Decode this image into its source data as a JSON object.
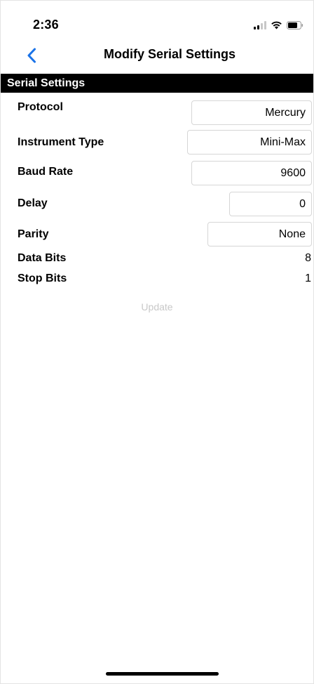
{
  "status_bar": {
    "time": "2:36"
  },
  "nav": {
    "back_icon": "chevron-left-icon",
    "title": "Modify Serial Settings"
  },
  "section": {
    "title": "Serial Settings"
  },
  "settings": {
    "protocol": {
      "label": "Protocol",
      "value": "Mercury"
    },
    "instrument_type": {
      "label": "Instrument Type",
      "value": "Mini-Max"
    },
    "baud_rate": {
      "label": "Baud Rate",
      "value": "9600"
    },
    "delay": {
      "label": "Delay",
      "value": "0"
    },
    "parity": {
      "label": "Parity",
      "value": "None"
    },
    "data_bits": {
      "label": "Data Bits",
      "value": "8"
    },
    "stop_bits": {
      "label": "Stop Bits",
      "value": "1"
    }
  },
  "actions": {
    "update_label": "Update"
  },
  "colors": {
    "accent": "#1a73e8",
    "header_bg": "#000000",
    "disabled_text": "#c8c8c8",
    "field_border": "#d6d6d6"
  }
}
